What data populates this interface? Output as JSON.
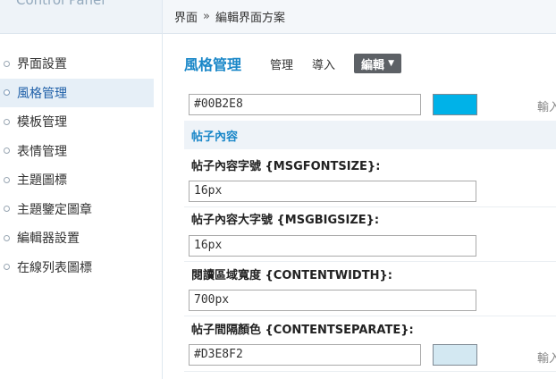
{
  "sidebar": {
    "title": "Control Panel",
    "items": [
      {
        "label": "界面設置"
      },
      {
        "label": "風格管理"
      },
      {
        "label": "模板管理"
      },
      {
        "label": "表情管理"
      },
      {
        "label": "主題圖標"
      },
      {
        "label": "主題鑒定圖章"
      },
      {
        "label": "編輯器設置"
      },
      {
        "label": "在線列表圖標"
      }
    ],
    "active_index": 1
  },
  "breadcrumb": {
    "parts": [
      "界面",
      "編輯界面方案"
    ],
    "separator": "»"
  },
  "main": {
    "section_title": "風格管理",
    "tabs": [
      {
        "label": "管理"
      },
      {
        "label": "導入"
      }
    ],
    "active_tab": {
      "label": "編輯"
    },
    "fields": {
      "top_color_value": "#00B2E8",
      "top_color_swatch": "#00B2E8",
      "truncated_text": "輸入",
      "section_label": "帖子內容",
      "msgfontsize_label": "帖子內容字號 {MSGFONTSIZE}:",
      "msgfontsize_value": "16px",
      "msgbigsize_label": "帖子內容大字號 {MSGBIGSIZE}:",
      "msgbigsize_value": "16px",
      "contentwidth_label": "閱讀區域寬度 {CONTENTWIDTH}:",
      "contentwidth_value": "700px",
      "contentseparate_label": "帖子間隔顏色 {CONTENTSEPARATE}:",
      "contentseparate_value": "#D3E8F2",
      "contentseparate_swatch": "#D3E8F2"
    }
  }
}
